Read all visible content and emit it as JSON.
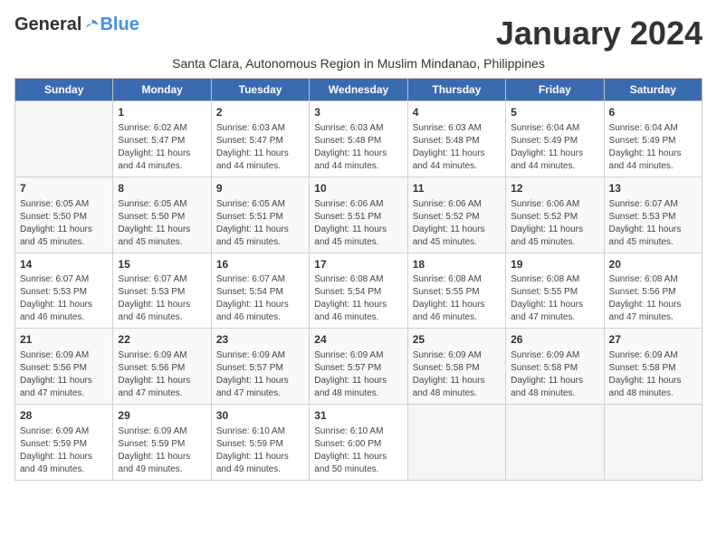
{
  "header": {
    "logo_general": "General",
    "logo_blue": "Blue",
    "month": "January 2024",
    "subtitle": "Santa Clara, Autonomous Region in Muslim Mindanao, Philippines"
  },
  "weekdays": [
    "Sunday",
    "Monday",
    "Tuesday",
    "Wednesday",
    "Thursday",
    "Friday",
    "Saturday"
  ],
  "weeks": [
    [
      {
        "day": "",
        "info": ""
      },
      {
        "day": "1",
        "info": "Sunrise: 6:02 AM\nSunset: 5:47 PM\nDaylight: 11 hours\nand 44 minutes."
      },
      {
        "day": "2",
        "info": "Sunrise: 6:03 AM\nSunset: 5:47 PM\nDaylight: 11 hours\nand 44 minutes."
      },
      {
        "day": "3",
        "info": "Sunrise: 6:03 AM\nSunset: 5:48 PM\nDaylight: 11 hours\nand 44 minutes."
      },
      {
        "day": "4",
        "info": "Sunrise: 6:03 AM\nSunset: 5:48 PM\nDaylight: 11 hours\nand 44 minutes."
      },
      {
        "day": "5",
        "info": "Sunrise: 6:04 AM\nSunset: 5:49 PM\nDaylight: 11 hours\nand 44 minutes."
      },
      {
        "day": "6",
        "info": "Sunrise: 6:04 AM\nSunset: 5:49 PM\nDaylight: 11 hours\nand 44 minutes."
      }
    ],
    [
      {
        "day": "7",
        "info": "Sunrise: 6:05 AM\nSunset: 5:50 PM\nDaylight: 11 hours\nand 45 minutes."
      },
      {
        "day": "8",
        "info": "Sunrise: 6:05 AM\nSunset: 5:50 PM\nDaylight: 11 hours\nand 45 minutes."
      },
      {
        "day": "9",
        "info": "Sunrise: 6:05 AM\nSunset: 5:51 PM\nDaylight: 11 hours\nand 45 minutes."
      },
      {
        "day": "10",
        "info": "Sunrise: 6:06 AM\nSunset: 5:51 PM\nDaylight: 11 hours\nand 45 minutes."
      },
      {
        "day": "11",
        "info": "Sunrise: 6:06 AM\nSunset: 5:52 PM\nDaylight: 11 hours\nand 45 minutes."
      },
      {
        "day": "12",
        "info": "Sunrise: 6:06 AM\nSunset: 5:52 PM\nDaylight: 11 hours\nand 45 minutes."
      },
      {
        "day": "13",
        "info": "Sunrise: 6:07 AM\nSunset: 5:53 PM\nDaylight: 11 hours\nand 45 minutes."
      }
    ],
    [
      {
        "day": "14",
        "info": "Sunrise: 6:07 AM\nSunset: 5:53 PM\nDaylight: 11 hours\nand 46 minutes."
      },
      {
        "day": "15",
        "info": "Sunrise: 6:07 AM\nSunset: 5:53 PM\nDaylight: 11 hours\nand 46 minutes."
      },
      {
        "day": "16",
        "info": "Sunrise: 6:07 AM\nSunset: 5:54 PM\nDaylight: 11 hours\nand 46 minutes."
      },
      {
        "day": "17",
        "info": "Sunrise: 6:08 AM\nSunset: 5:54 PM\nDaylight: 11 hours\nand 46 minutes."
      },
      {
        "day": "18",
        "info": "Sunrise: 6:08 AM\nSunset: 5:55 PM\nDaylight: 11 hours\nand 46 minutes."
      },
      {
        "day": "19",
        "info": "Sunrise: 6:08 AM\nSunset: 5:55 PM\nDaylight: 11 hours\nand 47 minutes."
      },
      {
        "day": "20",
        "info": "Sunrise: 6:08 AM\nSunset: 5:56 PM\nDaylight: 11 hours\nand 47 minutes."
      }
    ],
    [
      {
        "day": "21",
        "info": "Sunrise: 6:09 AM\nSunset: 5:56 PM\nDaylight: 11 hours\nand 47 minutes."
      },
      {
        "day": "22",
        "info": "Sunrise: 6:09 AM\nSunset: 5:56 PM\nDaylight: 11 hours\nand 47 minutes."
      },
      {
        "day": "23",
        "info": "Sunrise: 6:09 AM\nSunset: 5:57 PM\nDaylight: 11 hours\nand 47 minutes."
      },
      {
        "day": "24",
        "info": "Sunrise: 6:09 AM\nSunset: 5:57 PM\nDaylight: 11 hours\nand 48 minutes."
      },
      {
        "day": "25",
        "info": "Sunrise: 6:09 AM\nSunset: 5:58 PM\nDaylight: 11 hours\nand 48 minutes."
      },
      {
        "day": "26",
        "info": "Sunrise: 6:09 AM\nSunset: 5:58 PM\nDaylight: 11 hours\nand 48 minutes."
      },
      {
        "day": "27",
        "info": "Sunrise: 6:09 AM\nSunset: 5:58 PM\nDaylight: 11 hours\nand 48 minutes."
      }
    ],
    [
      {
        "day": "28",
        "info": "Sunrise: 6:09 AM\nSunset: 5:59 PM\nDaylight: 11 hours\nand 49 minutes."
      },
      {
        "day": "29",
        "info": "Sunrise: 6:09 AM\nSunset: 5:59 PM\nDaylight: 11 hours\nand 49 minutes."
      },
      {
        "day": "30",
        "info": "Sunrise: 6:10 AM\nSunset: 5:59 PM\nDaylight: 11 hours\nand 49 minutes."
      },
      {
        "day": "31",
        "info": "Sunrise: 6:10 AM\nSunset: 6:00 PM\nDaylight: 11 hours\nand 50 minutes."
      },
      {
        "day": "",
        "info": ""
      },
      {
        "day": "",
        "info": ""
      },
      {
        "day": "",
        "info": ""
      }
    ]
  ]
}
